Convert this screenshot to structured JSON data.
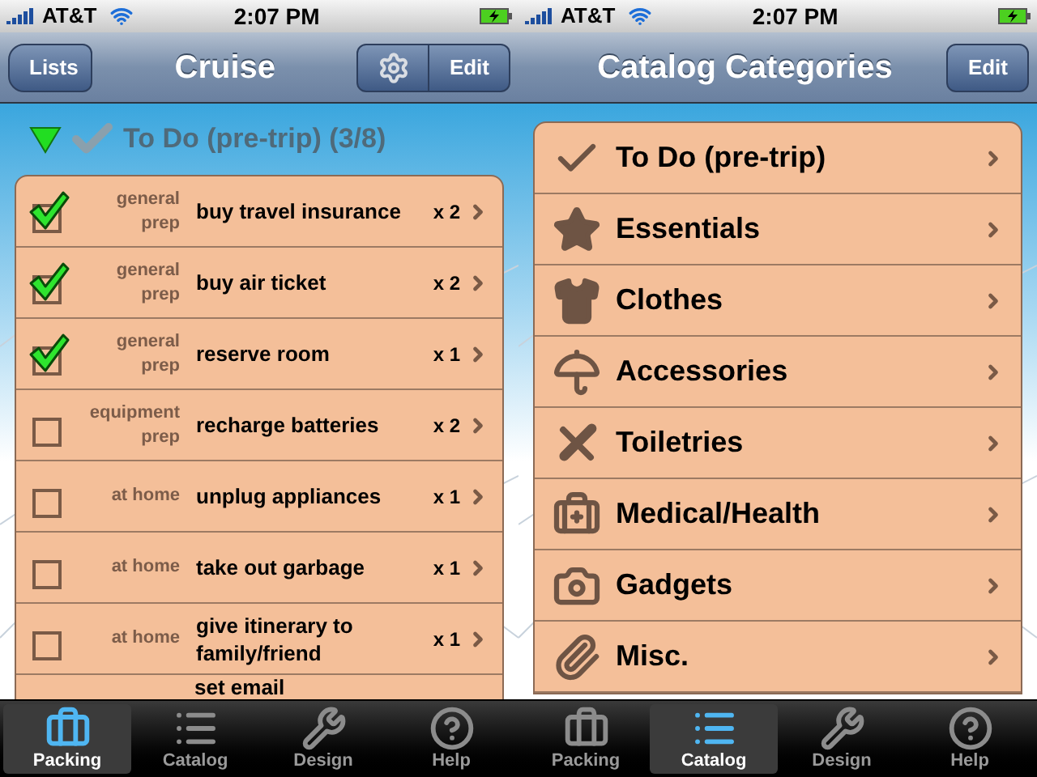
{
  "screens": [
    {
      "kind": "checklist",
      "status_bar": {
        "carrier": "AT&T",
        "time": "2:07 PM",
        "charging": true
      },
      "nav": {
        "back": "Lists",
        "title": "Cruise",
        "edit": "Edit",
        "settings": true
      },
      "section": {
        "title": "To Do (pre-trip) (3/8)",
        "expanded": true
      },
      "items": [
        {
          "category": "general prep",
          "name": "buy travel insurance",
          "qty": "x 2",
          "checked": true
        },
        {
          "category": "general prep",
          "name": "buy air ticket",
          "qty": "x 2",
          "checked": true
        },
        {
          "category": "general prep",
          "name": "reserve room",
          "qty": "x 1",
          "checked": true
        },
        {
          "category": "equipment prep",
          "name": "recharge batteries",
          "qty": "x 2",
          "checked": false
        },
        {
          "category": "at home",
          "name": "unplug appliances",
          "qty": "x 1",
          "checked": false
        },
        {
          "category": "at home",
          "name": "take out garbage",
          "qty": "x 1",
          "checked": false
        },
        {
          "category": "at home",
          "name": "give itinerary to family/friend",
          "qty": "x 1",
          "checked": false
        },
        {
          "name": "set email",
          "partial": true
        }
      ],
      "tabs": [
        {
          "label": "Packing",
          "selected": true
        },
        {
          "label": "Catalog",
          "selected": false
        },
        {
          "label": "Design",
          "selected": false
        },
        {
          "label": "Help",
          "selected": false
        }
      ]
    },
    {
      "kind": "categories",
      "status_bar": {
        "carrier": "AT&T",
        "time": "2:07 PM",
        "charging": true
      },
      "nav": {
        "title": "Catalog Categories",
        "edit": "Edit"
      },
      "items": [
        {
          "name": "To Do (pre-trip)"
        },
        {
          "name": "Essentials"
        },
        {
          "name": "Clothes"
        },
        {
          "name": "Accessories"
        },
        {
          "name": "Toiletries"
        },
        {
          "name": "Medical/Health"
        },
        {
          "name": "Gadgets"
        },
        {
          "name": "Misc."
        }
      ],
      "tabs": [
        {
          "label": "Packing",
          "selected": false
        },
        {
          "label": "Catalog",
          "selected": true
        },
        {
          "label": "Design",
          "selected": false
        },
        {
          "label": "Help",
          "selected": false
        }
      ]
    }
  ]
}
